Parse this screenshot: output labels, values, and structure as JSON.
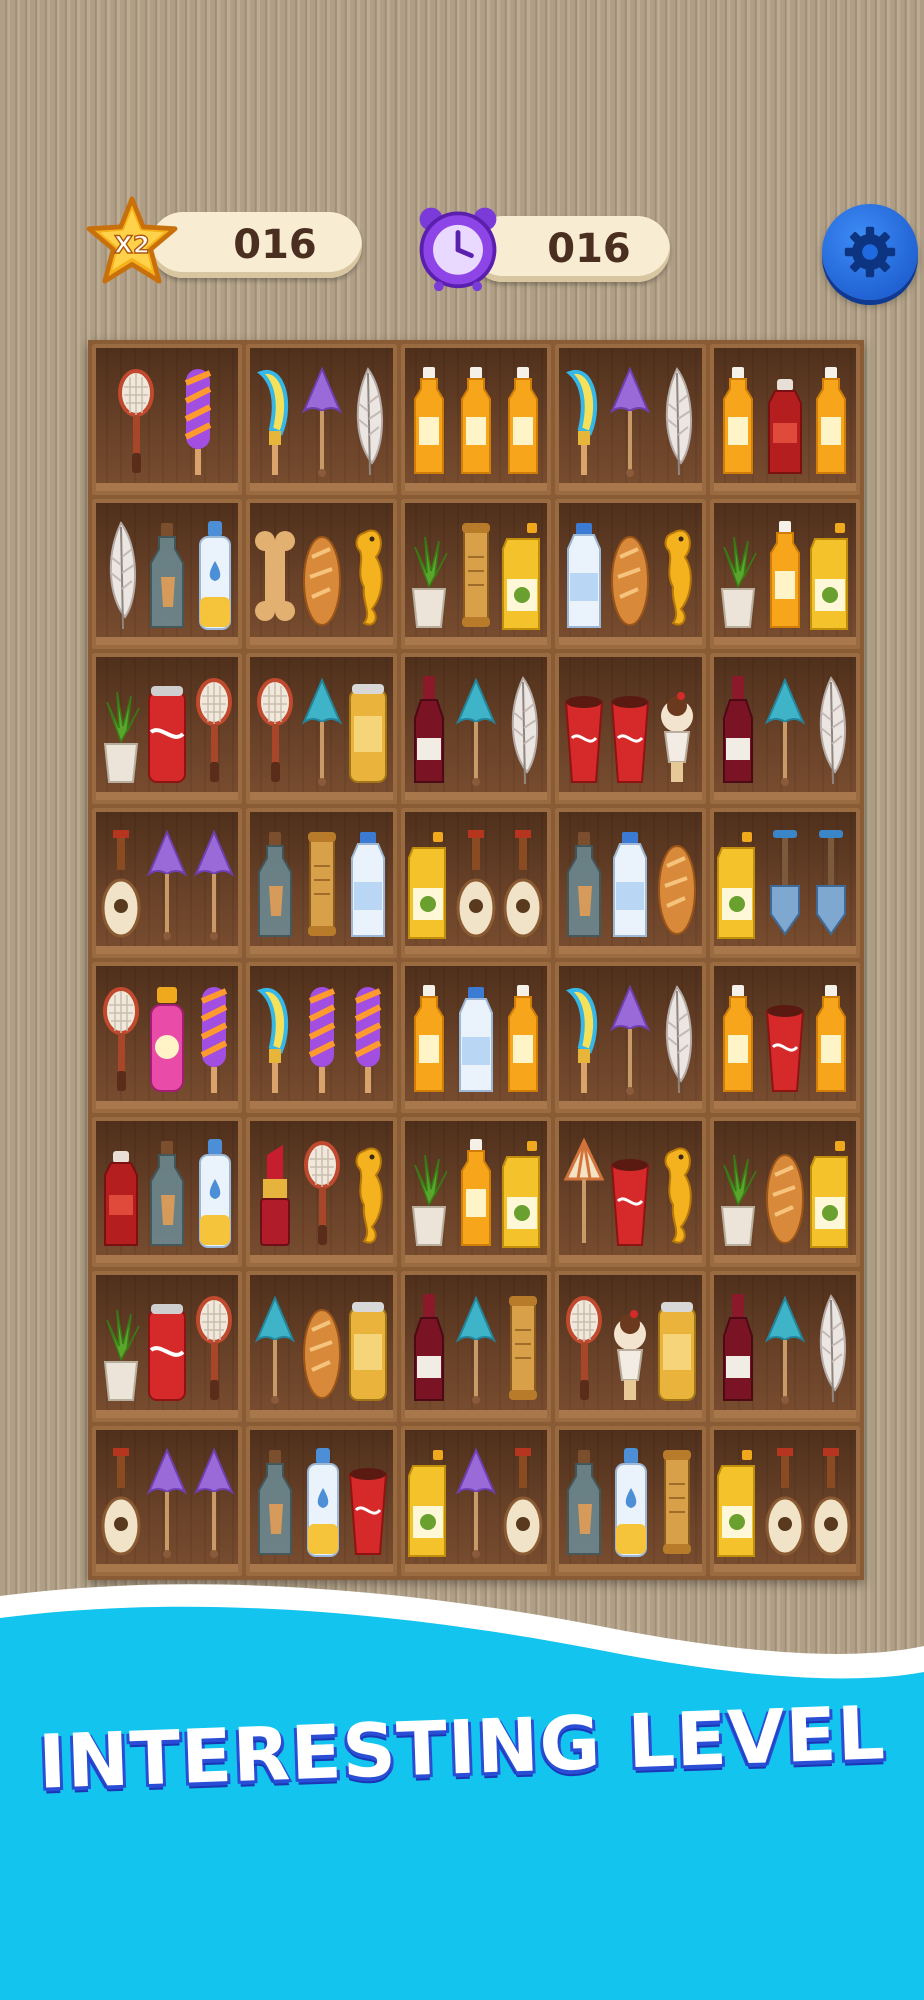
{
  "hud": {
    "multiplier": "X2",
    "score": "016",
    "timer": "016"
  },
  "icons": {
    "multiplier_badge": "star-icon",
    "timer_badge": "alarm-clock-icon",
    "settings": "gear-icon"
  },
  "colors": {
    "settings_button": "#1f6ae0",
    "banner_background": "#0fc3ec",
    "banner_text_outline": "#2a4dd6"
  },
  "shelf": {
    "columns": 5,
    "rows": [
      [
        [
          "racket",
          "popsicle"
        ],
        [
          "banana",
          "umbrella-purple",
          "feather"
        ],
        [
          "juice",
          "juice",
          "juice"
        ],
        [
          "banana",
          "umbrella-purple",
          "feather"
        ],
        [
          "juice",
          "ketchup",
          "juice"
        ]
      ],
      [
        [
          "feather",
          "bottle-ship",
          "lotion"
        ],
        [
          "bone",
          "bread",
          "seahorse"
        ],
        [
          "plant",
          "scroll",
          "oil"
        ],
        [
          "milk",
          "bread",
          "seahorse"
        ],
        [
          "plant",
          "juice",
          "oil"
        ]
      ],
      [
        [
          "plant",
          "soda-can",
          "racket"
        ],
        [
          "racket",
          "umbrella-teal",
          "beer-can"
        ],
        [
          "wine",
          "umbrella-teal",
          "feather"
        ],
        [
          "cola-cup",
          "cola-cup",
          "ice-cream"
        ],
        [
          "wine",
          "umbrella-teal",
          "feather"
        ]
      ],
      [
        [
          "lute",
          "umbrella-purple",
          "umbrella-purple"
        ],
        [
          "bottle-ship",
          "scroll",
          "milk"
        ],
        [
          "oil",
          "lute",
          "lute"
        ],
        [
          "bottle-ship",
          "milk",
          "bread"
        ],
        [
          "oil",
          "shovel",
          "shovel"
        ]
      ],
      [
        [
          "racket",
          "jelly-jar",
          "popsicle"
        ],
        [
          "banana",
          "popsicle",
          "popsicle"
        ],
        [
          "juice",
          "milk",
          "juice"
        ],
        [
          "banana",
          "umbrella-purple",
          "feather"
        ],
        [
          "juice",
          "cola-cup",
          "juice"
        ]
      ],
      [
        [
          "ketchup",
          "bottle-ship",
          "lotion"
        ],
        [
          "lipstick",
          "racket",
          "seahorse"
        ],
        [
          "plant",
          "juice",
          "oil"
        ],
        [
          "umbrella-beach",
          "cola-cup",
          "seahorse"
        ],
        [
          "plant",
          "bread",
          "oil"
        ]
      ],
      [
        [
          "plant",
          "soda-can",
          "racket"
        ],
        [
          "umbrella-teal",
          "bread",
          "beer-can"
        ],
        [
          "wine",
          "umbrella-teal",
          "scroll"
        ],
        [
          "racket",
          "ice-cream",
          "beer-can"
        ],
        [
          "wine",
          "umbrella-teal",
          "feather"
        ]
      ],
      [
        [
          "lute",
          "umbrella-purple",
          "umbrella-purple"
        ],
        [
          "bottle-ship",
          "lotion",
          "cola-cup"
        ],
        [
          "oil",
          "umbrella-purple",
          "lute"
        ],
        [
          "bottle-ship",
          "lotion",
          "scroll"
        ],
        [
          "oil",
          "lute",
          "lute"
        ]
      ]
    ]
  },
  "banner": {
    "text": "INTERESTING LEVEL"
  }
}
